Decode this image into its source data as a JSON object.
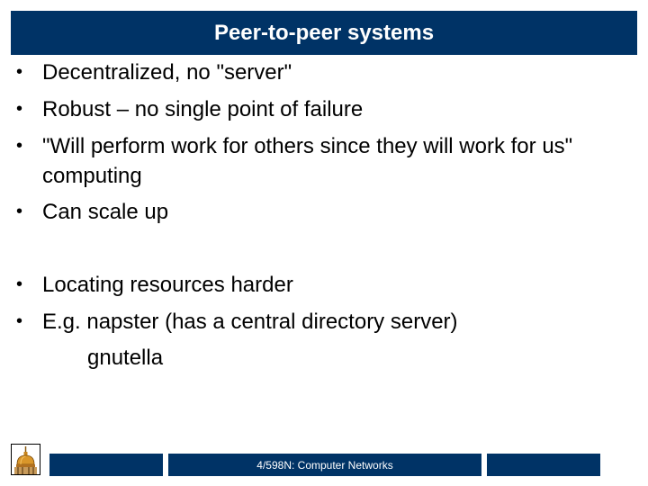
{
  "slide": {
    "title": "Peer-to-peer systems",
    "bullets_group1": [
      "Decentralized, no \"server\"",
      "Robust – no single point of failure",
      "\"Will perform work for others since they will work for us\" computing",
      "Can scale up"
    ],
    "bullets_group2": [
      "Locating resources harder",
      "E.g. napster (has a central directory server)"
    ],
    "indented_line": "gnutella",
    "bullet_glyph": "•"
  },
  "footer": {
    "course_label": "4/598N: Computer Networks",
    "logo_icon": "golden-dome-icon"
  },
  "colors": {
    "brand_navy": "#003366",
    "text": "#000000",
    "background": "#ffffff"
  }
}
